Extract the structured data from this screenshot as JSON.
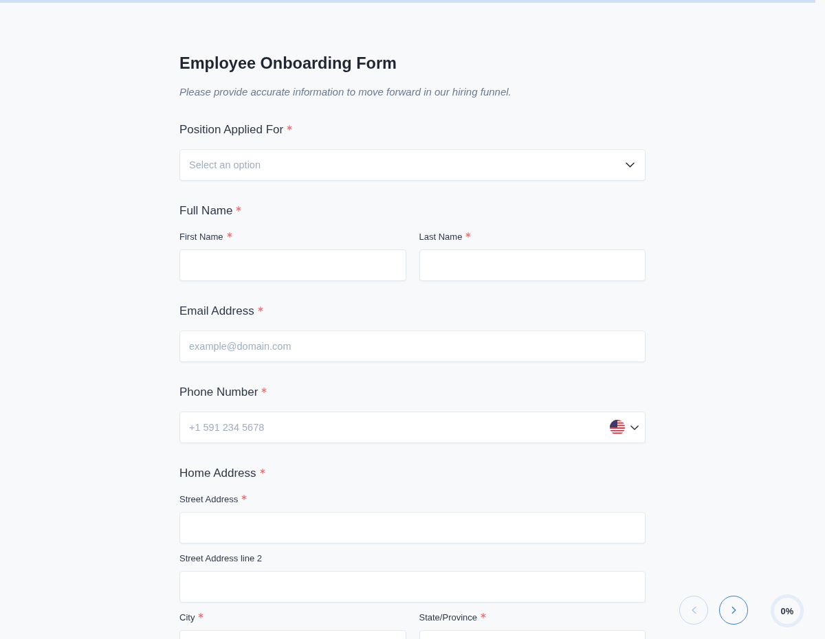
{
  "form": {
    "title": "Employee Onboarding Form",
    "subtitle": "Please provide accurate information to move forward in our hiring funnel."
  },
  "fields": [
    {
      "kind": "select",
      "label": "Position Applied For",
      "required": true,
      "placeholder": "Select an option"
    },
    {
      "kind": "group",
      "label": "Full Name",
      "required": true,
      "rows": [
        [
          {
            "label": "First Name",
            "required": true
          },
          {
            "label": "Last Name",
            "required": true
          }
        ]
      ]
    },
    {
      "kind": "email",
      "label": "Email Address",
      "required": true,
      "placeholder": "example@domain.com"
    },
    {
      "kind": "phone",
      "label": "Phone Number",
      "required": true,
      "placeholder": "+1 591 234 5678"
    },
    {
      "kind": "group",
      "label": "Home Address",
      "required": true,
      "rows": [
        [
          {
            "label": "Street Address",
            "required": true
          }
        ],
        [
          {
            "label": "Street Address line 2",
            "required": false
          }
        ],
        [
          {
            "label": "City",
            "required": true
          },
          {
            "label": "State/Province",
            "required": true
          }
        ]
      ]
    }
  ],
  "nav_buttons": [
    {
      "kind": "previous",
      "disabled": true
    },
    {
      "kind": "next",
      "disabled": false
    }
  ],
  "progress": {
    "level": 0,
    "reading": "0%"
  }
}
